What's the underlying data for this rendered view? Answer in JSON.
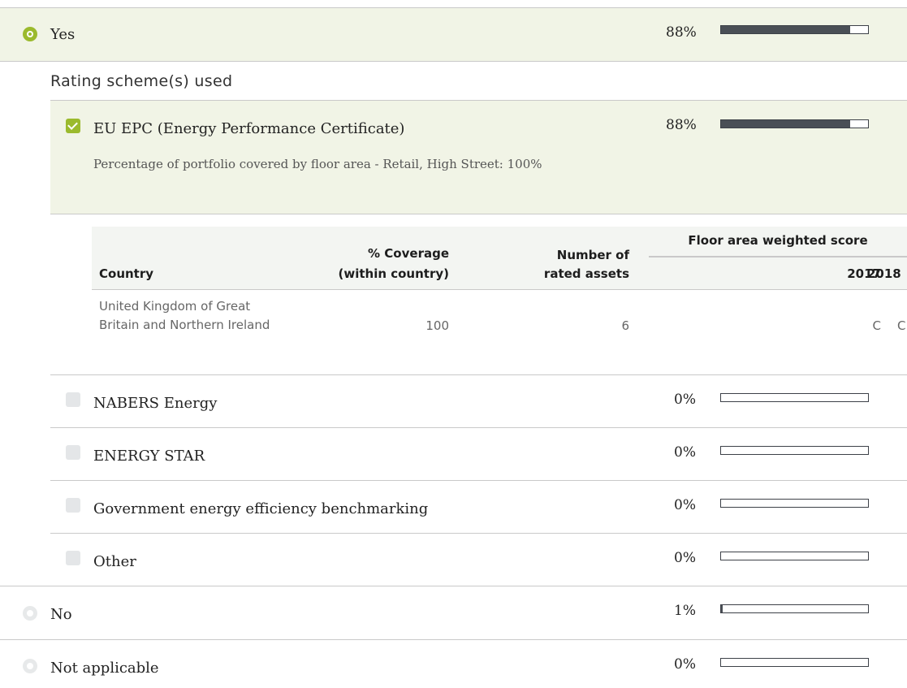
{
  "options": {
    "yes": {
      "label": "Yes",
      "percent": "88%",
      "fill": 0.88
    },
    "no": {
      "label": "No",
      "percent": "1%",
      "fill": 0.01
    },
    "not_applicable": {
      "label": "Not applicable",
      "percent": "0%",
      "fill": 0
    }
  },
  "rating_section": {
    "heading": "Rating scheme(s) used"
  },
  "schemes": {
    "eu_epc": {
      "label": "EU EPC (Energy Performance Certificate)",
      "percent": "88%",
      "fill": 0.88,
      "note": "Percentage of portfolio covered by floor area - Retail, High Street: 100%"
    },
    "nabers": {
      "label": "NABERS Energy",
      "percent": "0%",
      "fill": 0
    },
    "energy_star": {
      "label": "ENERGY STAR",
      "percent": "0%",
      "fill": 0
    },
    "gov_benchmarking": {
      "label": "Government energy efficiency benchmarking",
      "percent": "0%",
      "fill": 0
    },
    "other": {
      "label": "Other",
      "percent": "0%",
      "fill": 0
    }
  },
  "table": {
    "headers": {
      "country": "Country",
      "coverage_line1": "% Coverage",
      "coverage_line2": "(within country)",
      "assets_line1": "Number of",
      "assets_line2": "rated assets",
      "group": "Floor area weighted score",
      "year1": "2017",
      "year2": "2018"
    },
    "rows": [
      {
        "country": "United Kingdom of Great Britain and Northern Ireland",
        "coverage": "100",
        "assets": "6",
        "score_2017": "C",
        "score_2018": "C"
      }
    ]
  },
  "colors": {
    "accent": "#9bba2d",
    "highlight": "#f1f4e6",
    "bar": "#4a4f56"
  }
}
